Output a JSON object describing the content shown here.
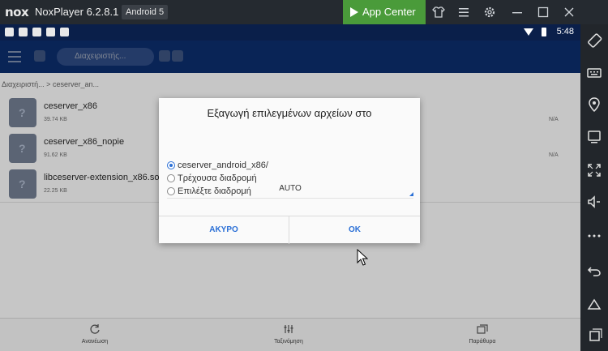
{
  "window": {
    "logo": "nox",
    "title": "NoxPlayer 6.2.8.1",
    "android_badge": "Android 5",
    "app_center": "App Center"
  },
  "status_bar": {
    "time": "5:48"
  },
  "app_bar": {
    "crumb": "Διαχειριστής..."
  },
  "path": {
    "text": "Διαχειριστή... > ceserver_an..."
  },
  "files": [
    {
      "name": "ceserver_x86",
      "size": "39.74 KB",
      "date": "N/A"
    },
    {
      "name": "ceserver_x86_nopie",
      "size": "91.62 KB",
      "date": "N/A"
    },
    {
      "name": "libceserver-extension_x86.so",
      "size": "22.25 KB",
      "date": ""
    }
  ],
  "bottom_bar": {
    "items": [
      {
        "label": "Ανανέωση",
        "icon": "refresh-icon"
      },
      {
        "label": "Ταξινόμηση",
        "icon": "sort-icon"
      },
      {
        "label": "Παράθυρα",
        "icon": "windows-icon"
      }
    ]
  },
  "dialog": {
    "title": "Εξαγωγή επιλεγμένων αρχείων στο",
    "options": [
      {
        "label": "ceserver_android_x86/",
        "selected": true
      },
      {
        "label": "Τρέχουσα διαδρομή",
        "selected": false
      },
      {
        "label": "Επιλέξτε διαδρομή",
        "selected": false
      }
    ],
    "encoding": "AUTO",
    "cancel": "ΑΚΥΡΟ",
    "ok": "OK"
  },
  "colors": {
    "accent": "#2a6fd6",
    "app_center_green": "#4a9b3a",
    "status_bar": "#0a1f4a"
  }
}
